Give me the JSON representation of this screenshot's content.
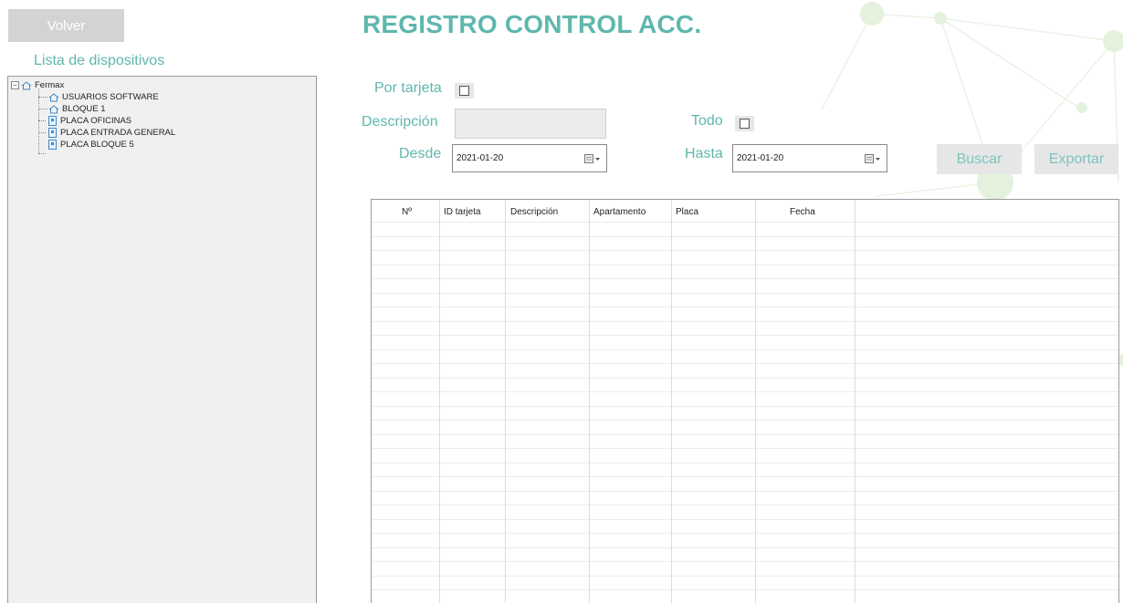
{
  "header": {
    "back_label": "Volver",
    "title": "REGISTRO CONTROL ACC."
  },
  "sidebar": {
    "title": "Lista de dispositivos",
    "tree": {
      "root": {
        "label": "Fermax",
        "icon": "home-icon",
        "expanded": true
      },
      "children": [
        {
          "label": "USUARIOS SOFTWARE",
          "icon": "home-icon"
        },
        {
          "label": "BLOQUE 1",
          "icon": "home-icon"
        },
        {
          "label": "PLACA OFICINAS",
          "icon": "panel-icon"
        },
        {
          "label": "PLACA ENTRADA GENERAL",
          "icon": "panel-icon"
        },
        {
          "label": "PLACA BLOQUE 5",
          "icon": "panel-icon"
        }
      ]
    }
  },
  "filters": {
    "by_card_label": "Por tarjeta",
    "by_card_checked": false,
    "description_label": "Descripción",
    "description_value": "",
    "all_label": "Todo",
    "all_checked": false,
    "from_label": "Desde",
    "from_value": "2021-01-20",
    "to_label": "Hasta",
    "to_value": "2021-01-20"
  },
  "actions": {
    "search_label": "Buscar",
    "export_label": "Exportar"
  },
  "table": {
    "columns": [
      "Nº",
      "ID tarjeta",
      "Descripción",
      "Apartamento",
      "Placa",
      "Fecha"
    ],
    "rows": []
  },
  "colors": {
    "accent": "#5fb7ad",
    "button_bg": "#d3d3d3",
    "panel_bg": "#f0f0f0"
  }
}
